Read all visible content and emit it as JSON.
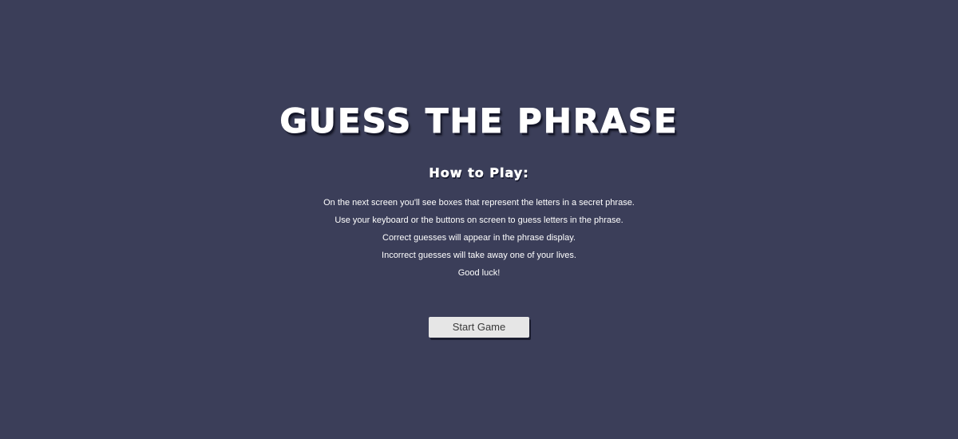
{
  "title": "Guess the Phrase",
  "howto": {
    "heading": "How to Play:",
    "lines": [
      "On the next screen you'll see boxes that represent the letters in a secret phrase.",
      "Use your keyboard or the buttons on screen to guess letters in the phrase.",
      "Correct guesses will appear in the phrase display.",
      "Incorrect guesses will take away one of your lives.",
      "Good luck!"
    ]
  },
  "start_button": {
    "label": "Start Game"
  },
  "colors": {
    "background": "#3b3e59",
    "text": "#ffffff",
    "button_bg": "#e6e6e6",
    "button_text": "#3a3a3a"
  }
}
